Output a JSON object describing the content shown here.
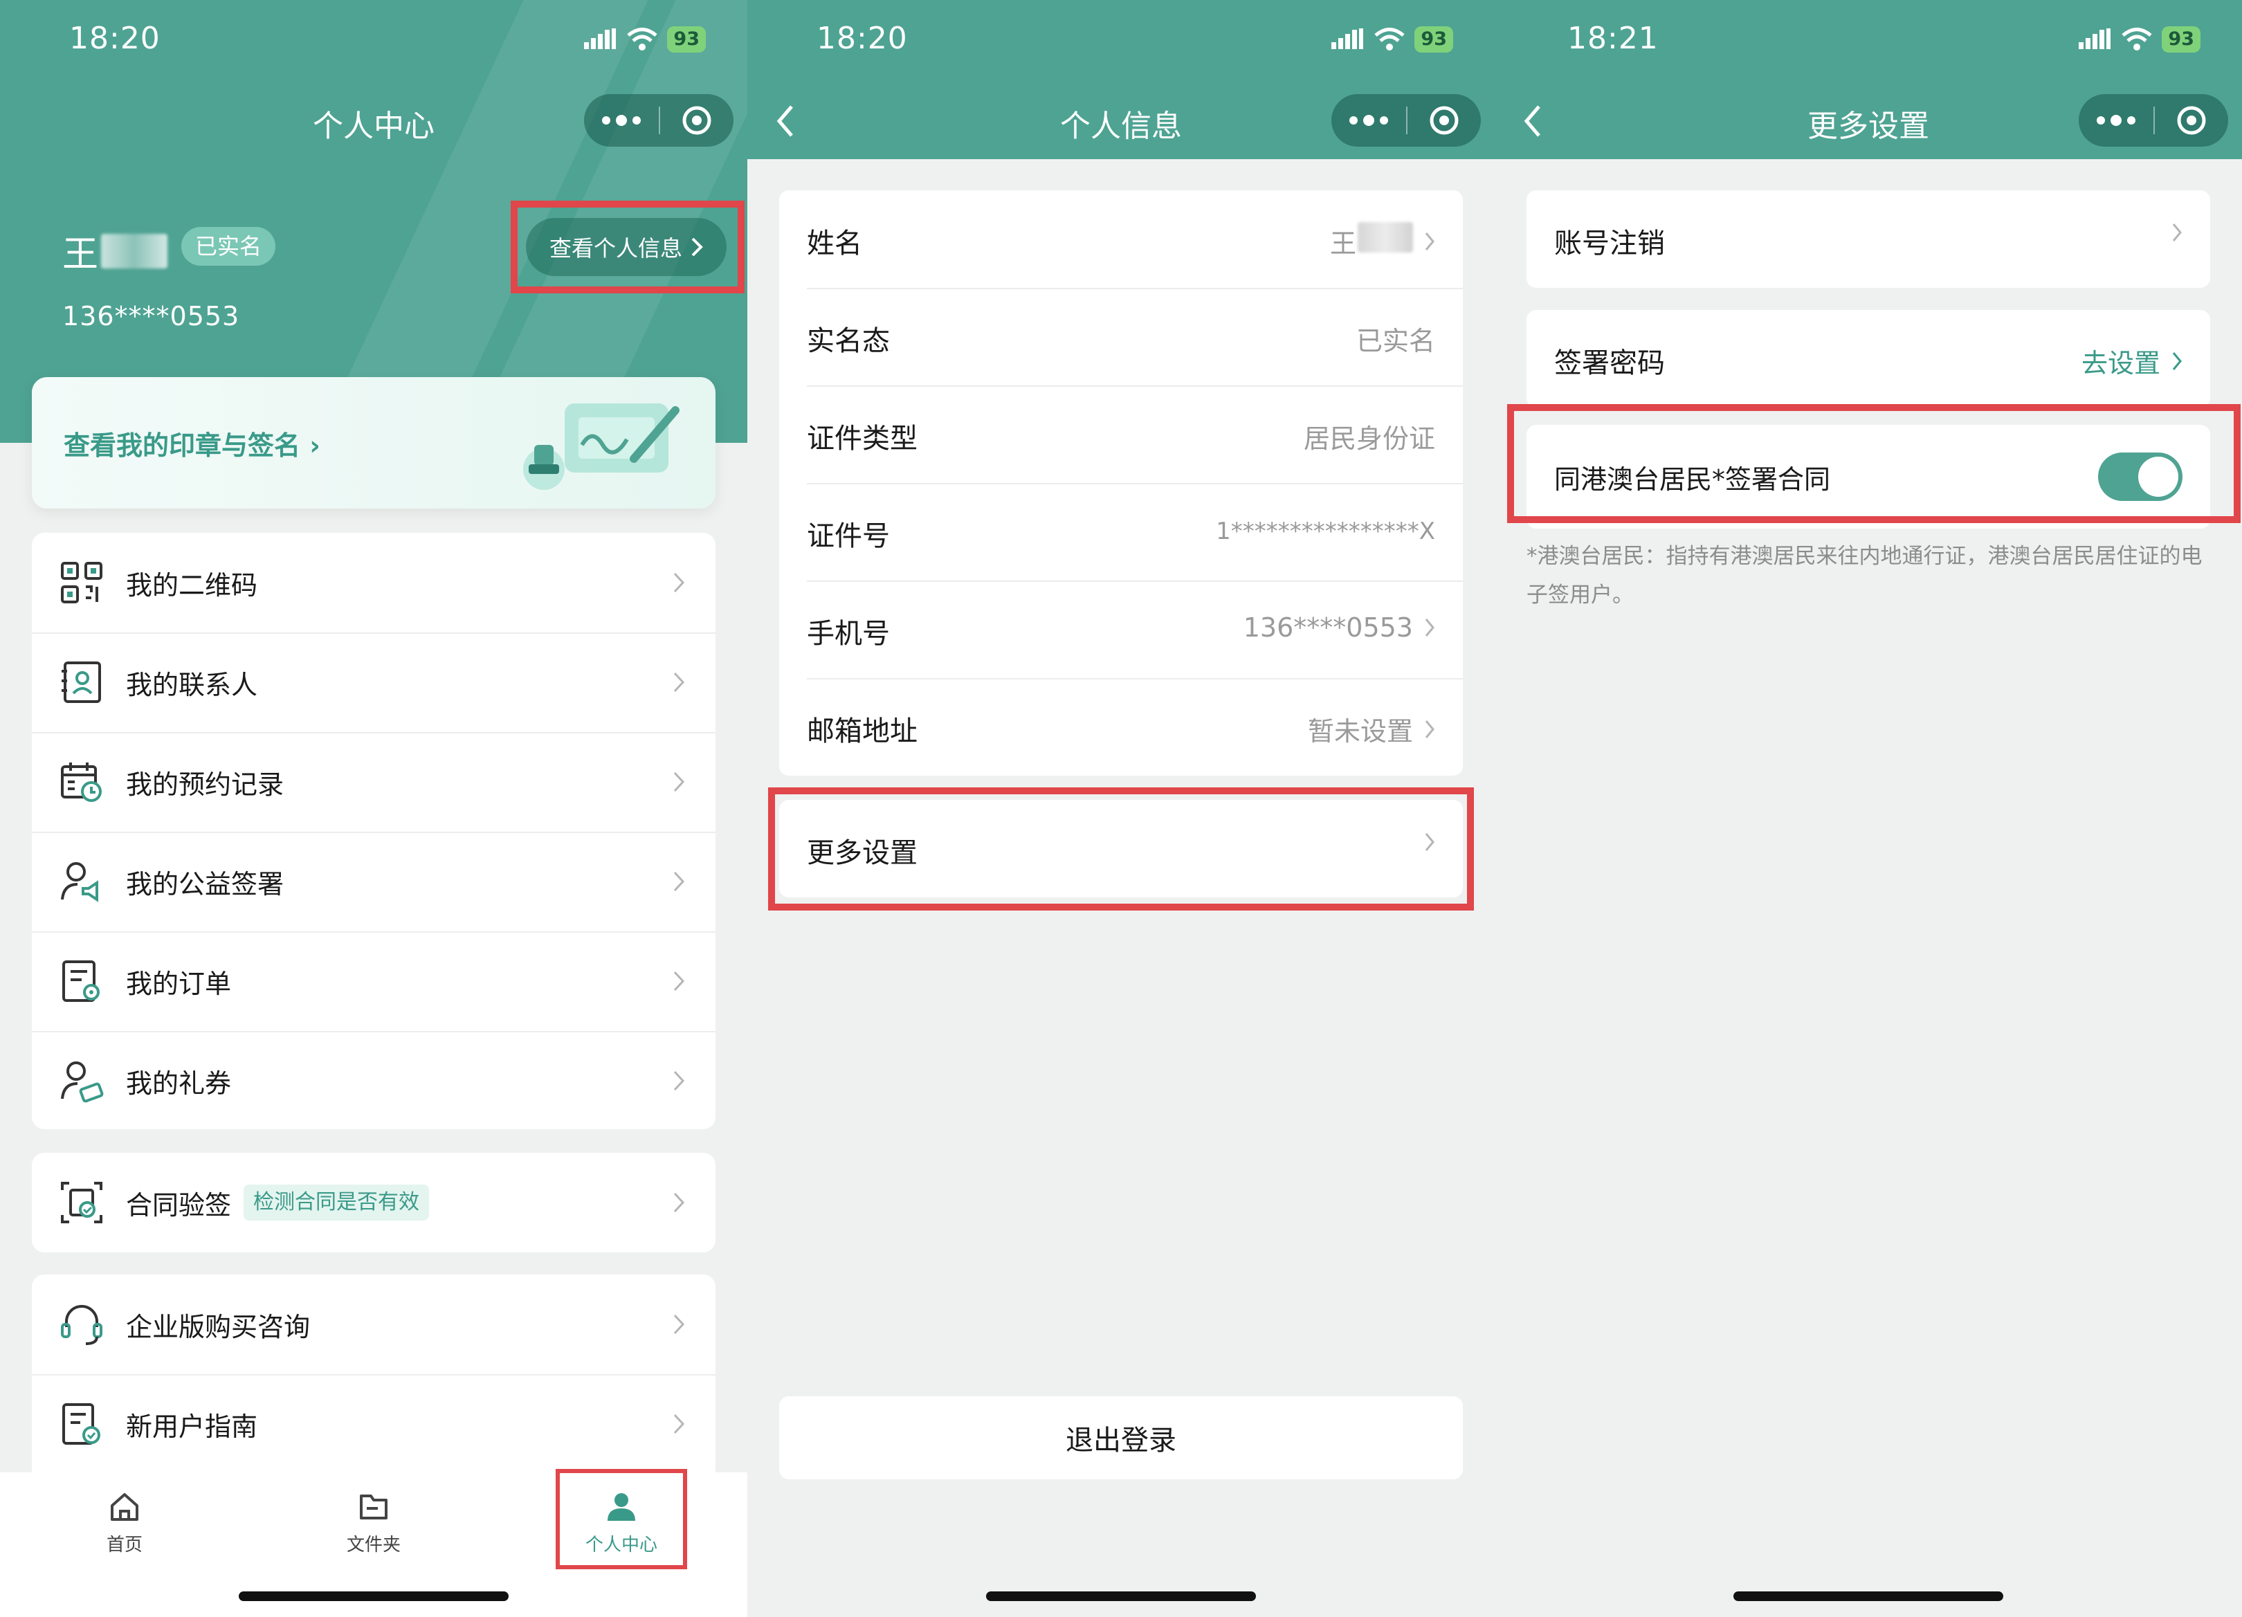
{
  "colors": {
    "brand": "#4fa393",
    "accent_text": "#3a9a89",
    "highlight": "#e0464a"
  },
  "status_bar": {
    "icons": [
      "signal-icon",
      "wifi-icon",
      "battery-icon"
    ],
    "battery": "93"
  },
  "panel1": {
    "time": "18:20",
    "nav_title": "个人中心",
    "user": {
      "name": "王",
      "badge": "已实名",
      "phone": "136****0553"
    },
    "view_info_button": "查看个人信息",
    "seal_card": "查看我的印章与签名",
    "menu": [
      {
        "label": "我的二维码",
        "icon": "qr-code-icon"
      },
      {
        "label": "我的联系人",
        "icon": "contact-book-icon"
      },
      {
        "label": "我的预约记录",
        "icon": "calendar-clock-icon"
      },
      {
        "label": "我的公益签署",
        "icon": "user-megaphone-icon"
      },
      {
        "label": "我的订单",
        "icon": "order-document-icon"
      },
      {
        "label": "我的礼券",
        "icon": "user-coupon-icon"
      }
    ],
    "verify": {
      "label": "合同验签",
      "tag": "检测合同是否有效",
      "icon": "contract-verify-icon"
    },
    "extra": [
      {
        "label": "企业版购买咨询",
        "icon": "headset-icon"
      },
      {
        "label": "新用户指南",
        "icon": "guide-document-icon"
      }
    ],
    "tabs": [
      {
        "label": "首页",
        "icon": "home-icon"
      },
      {
        "label": "文件夹",
        "icon": "folder-icon"
      },
      {
        "label": "个人中心",
        "icon": "person-icon"
      }
    ]
  },
  "panel2": {
    "time": "18:20",
    "nav_title": "个人信息",
    "rows": [
      {
        "label": "姓名",
        "value": "王"
      },
      {
        "label": "实名态",
        "value": "已实名"
      },
      {
        "label": "证件类型",
        "value": "居民身份证"
      },
      {
        "label": "证件号",
        "value": "1****************X"
      },
      {
        "label": "手机号",
        "value": "136****0553"
      },
      {
        "label": "邮箱地址",
        "value": "暂未设置"
      }
    ],
    "more_settings": "更多设置",
    "logout": "退出登录"
  },
  "panel3": {
    "time": "18:21",
    "nav_title": "更多设置",
    "cancel_account": "账号注销",
    "sign_password": {
      "label": "签署密码",
      "action": "去设置"
    },
    "hk_toggle": {
      "label": "同港澳台居民*签署合同",
      "enabled": true
    },
    "note": "*港澳台居民：指持有港澳居民来往内地通行证，港澳台居民居住证的电子签用户。"
  }
}
